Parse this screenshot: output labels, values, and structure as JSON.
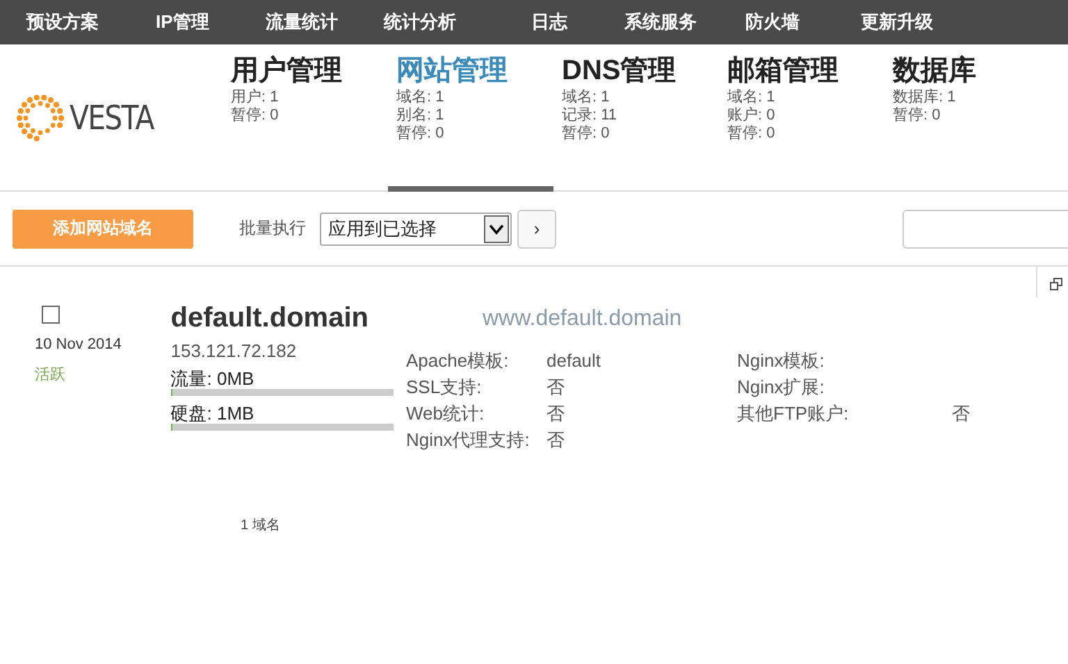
{
  "top_menu": [
    {
      "label": "预设方案"
    },
    {
      "label": "IP管理"
    },
    {
      "label": "流量统计"
    },
    {
      "label": "统计分析"
    },
    {
      "label": "日志"
    },
    {
      "label": "系统服务"
    },
    {
      "label": "防火墙"
    },
    {
      "label": "更新升级"
    }
  ],
  "logo": {
    "text": "VESTA"
  },
  "sections": [
    {
      "title": "用户管理",
      "selected": false,
      "stats": [
        "用户: 1",
        "暂停: 0"
      ]
    },
    {
      "title": "网站管理",
      "selected": true,
      "stats": [
        "域名: 1",
        "别名: 1",
        "暂停: 0"
      ]
    },
    {
      "title": "DNS管理",
      "selected": false,
      "stats": [
        "域名: 1",
        "记录: 11",
        "暂停: 0"
      ]
    },
    {
      "title": "邮箱管理",
      "selected": false,
      "stats": [
        "域名: 1",
        "账户: 0",
        "暂停: 0"
      ]
    },
    {
      "title": "数据库",
      "selected": false,
      "stats": [
        "数据库: 1",
        "暂停: 0"
      ]
    }
  ],
  "toolbar": {
    "add_button": "添加网站域名",
    "bulk_label": "批量执行",
    "bulk_select": "应用到已选择",
    "apply_button": "›"
  },
  "domains": [
    {
      "checked": false,
      "date": "10 Nov 2014",
      "status": "活跃",
      "name": "default.domain",
      "alias": "www.default.domain",
      "ip": "153.121.72.182",
      "meters": [
        {
          "label": "流量: 0MB",
          "level": 0.01
        },
        {
          "label": "硬盘: 1MB",
          "level": 0.01
        }
      ],
      "details": [
        [
          {
            "label": "Apache模板:",
            "value": "default"
          },
          {
            "label": "SSL支持:",
            "value": "否"
          },
          {
            "label": "Web统计:",
            "value": "否"
          },
          {
            "label": "Nginx代理支持:",
            "value": "否"
          }
        ],
        [
          {
            "label": "Nginx模板:"
          },
          {
            "label": "Nginx扩展:"
          },
          {
            "label": "其他FTP账户:",
            "value": "否"
          }
        ]
      ]
    }
  ],
  "footer": {
    "count": "1 域名"
  }
}
